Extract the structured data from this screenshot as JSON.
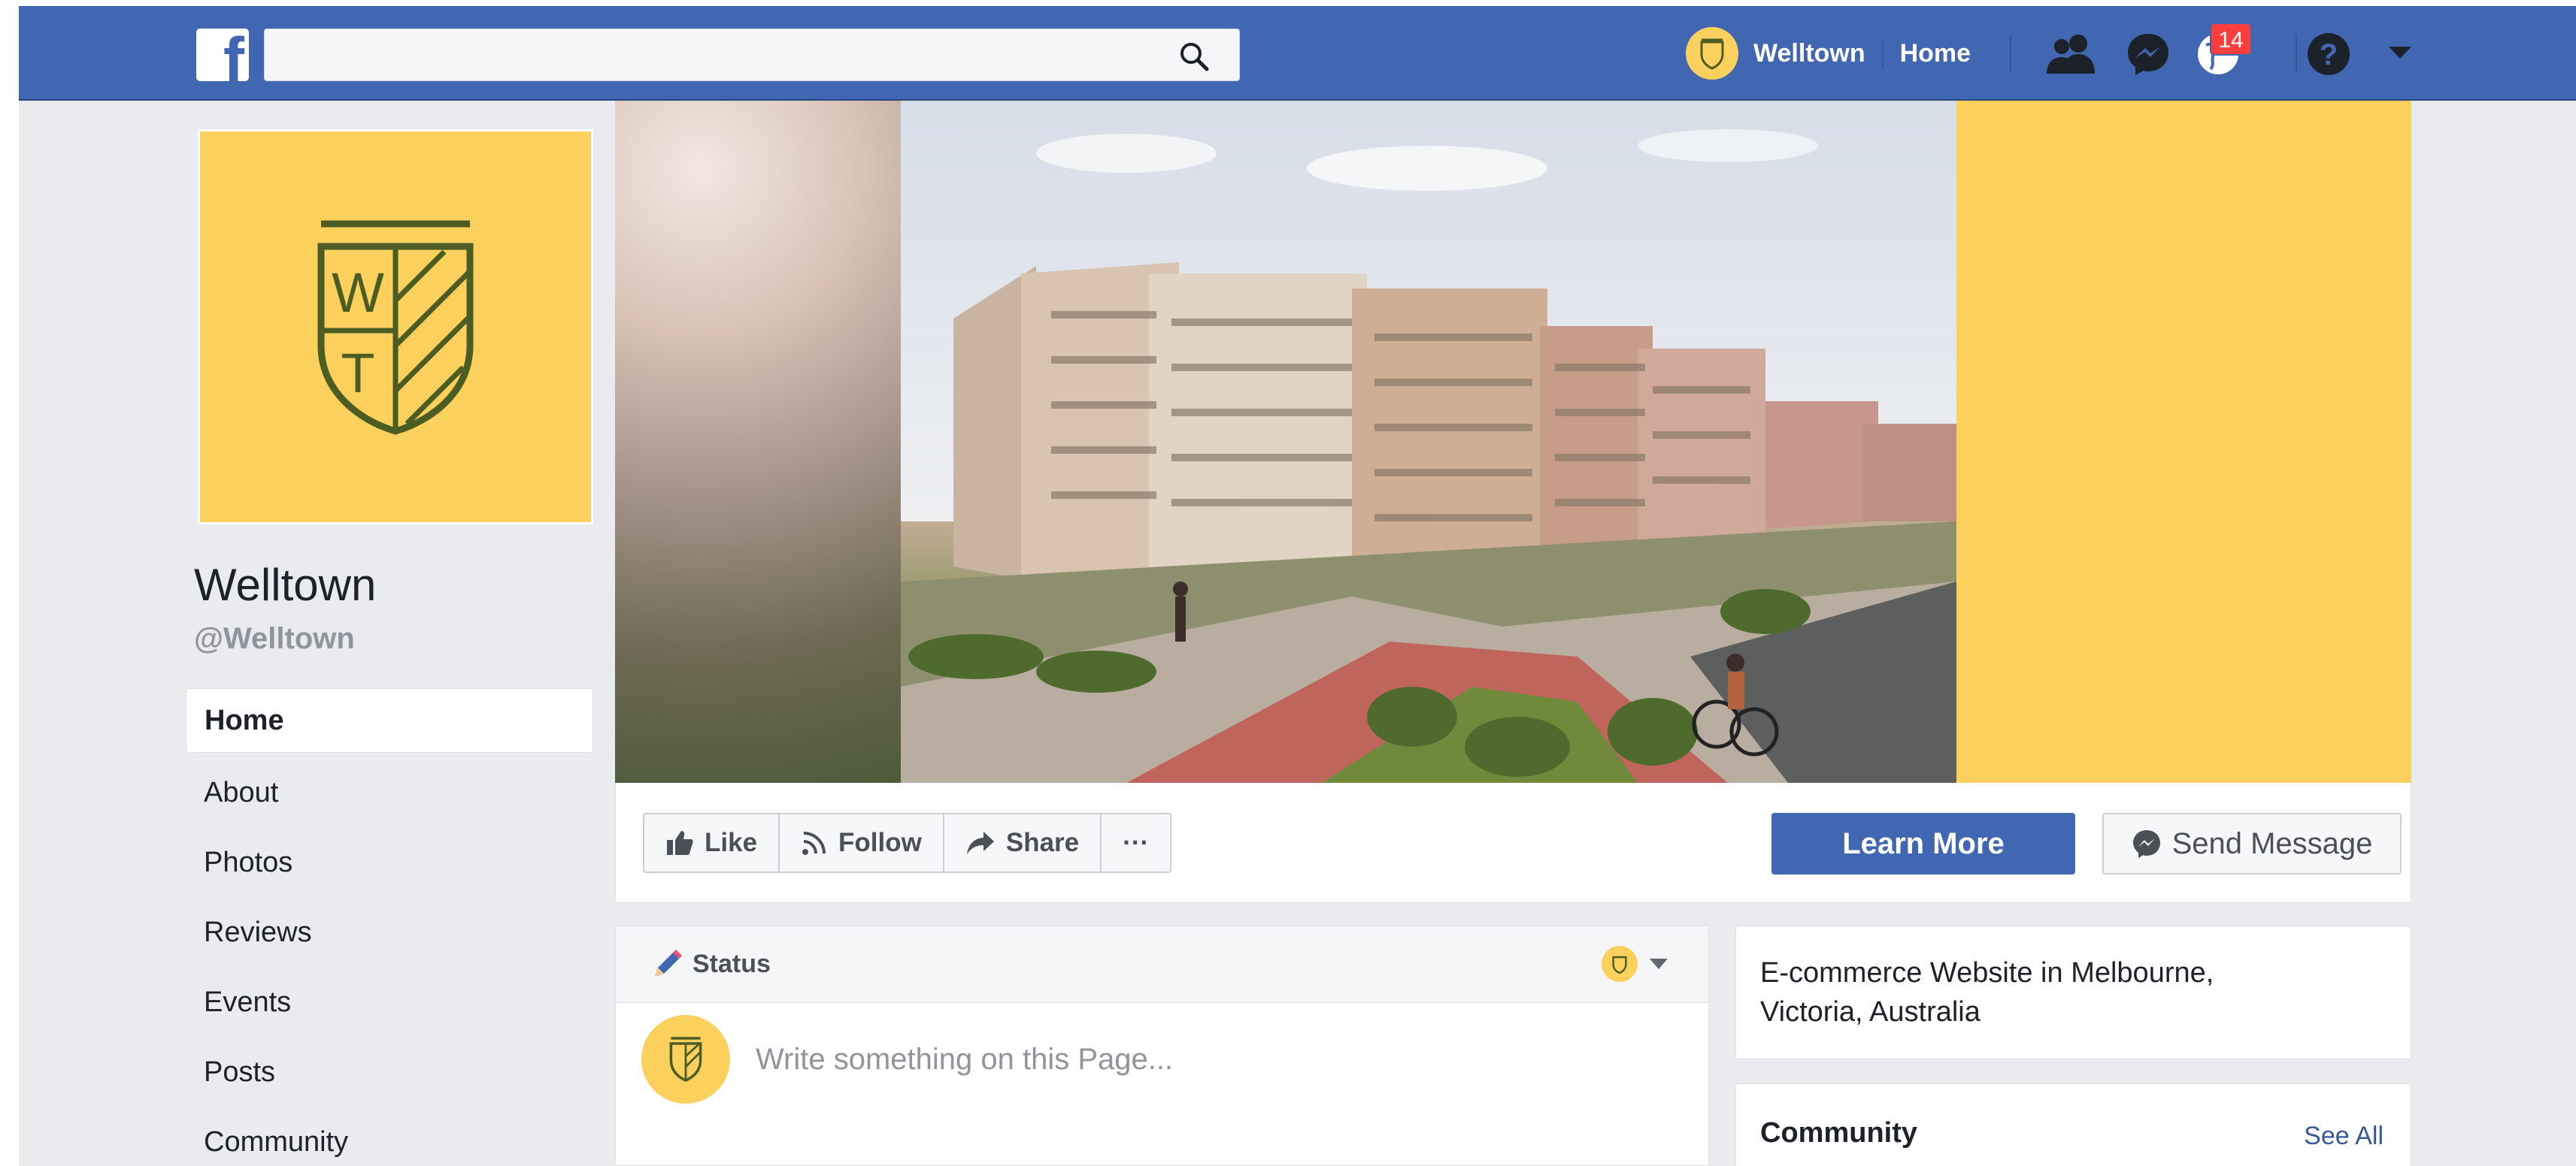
{
  "topbar": {
    "logo": "f",
    "search_placeholder": "",
    "page_name": "Welltown",
    "home_label": "Home",
    "notification_count": "14"
  },
  "colors": {
    "brand_blue": "#4267b2",
    "brand_yellow": "#fcd05c",
    "logo_green": "#4b5d23"
  },
  "profile": {
    "logo_letters": [
      "W",
      "T"
    ],
    "name": "Welltown",
    "handle": "@Welltown"
  },
  "nav": {
    "items": [
      {
        "label": "Home",
        "active": true
      },
      {
        "label": "About"
      },
      {
        "label": "Photos"
      },
      {
        "label": "Reviews"
      },
      {
        "label": "Events"
      },
      {
        "label": "Posts"
      },
      {
        "label": "Community"
      }
    ]
  },
  "actions": {
    "like": "Like",
    "follow": "Follow",
    "share": "Share",
    "more": "···",
    "learn_more": "Learn More",
    "send_message": "Send Message"
  },
  "composer": {
    "tab_label": "Status",
    "placeholder": "Write something on this Page..."
  },
  "about": {
    "line1": "E-commerce Website in Melbourne,",
    "line2": "Victoria, Australia"
  },
  "community": {
    "title": "Community",
    "see_all": "See All"
  },
  "icons": [
    "facebook-logo-icon",
    "search-icon",
    "friends-icon",
    "messenger-icon",
    "globe-icon",
    "help-icon",
    "dropdown-icon",
    "thumbs-up-icon",
    "rss-icon",
    "share-arrow-icon",
    "pencil-icon",
    "messenger-small-icon"
  ]
}
